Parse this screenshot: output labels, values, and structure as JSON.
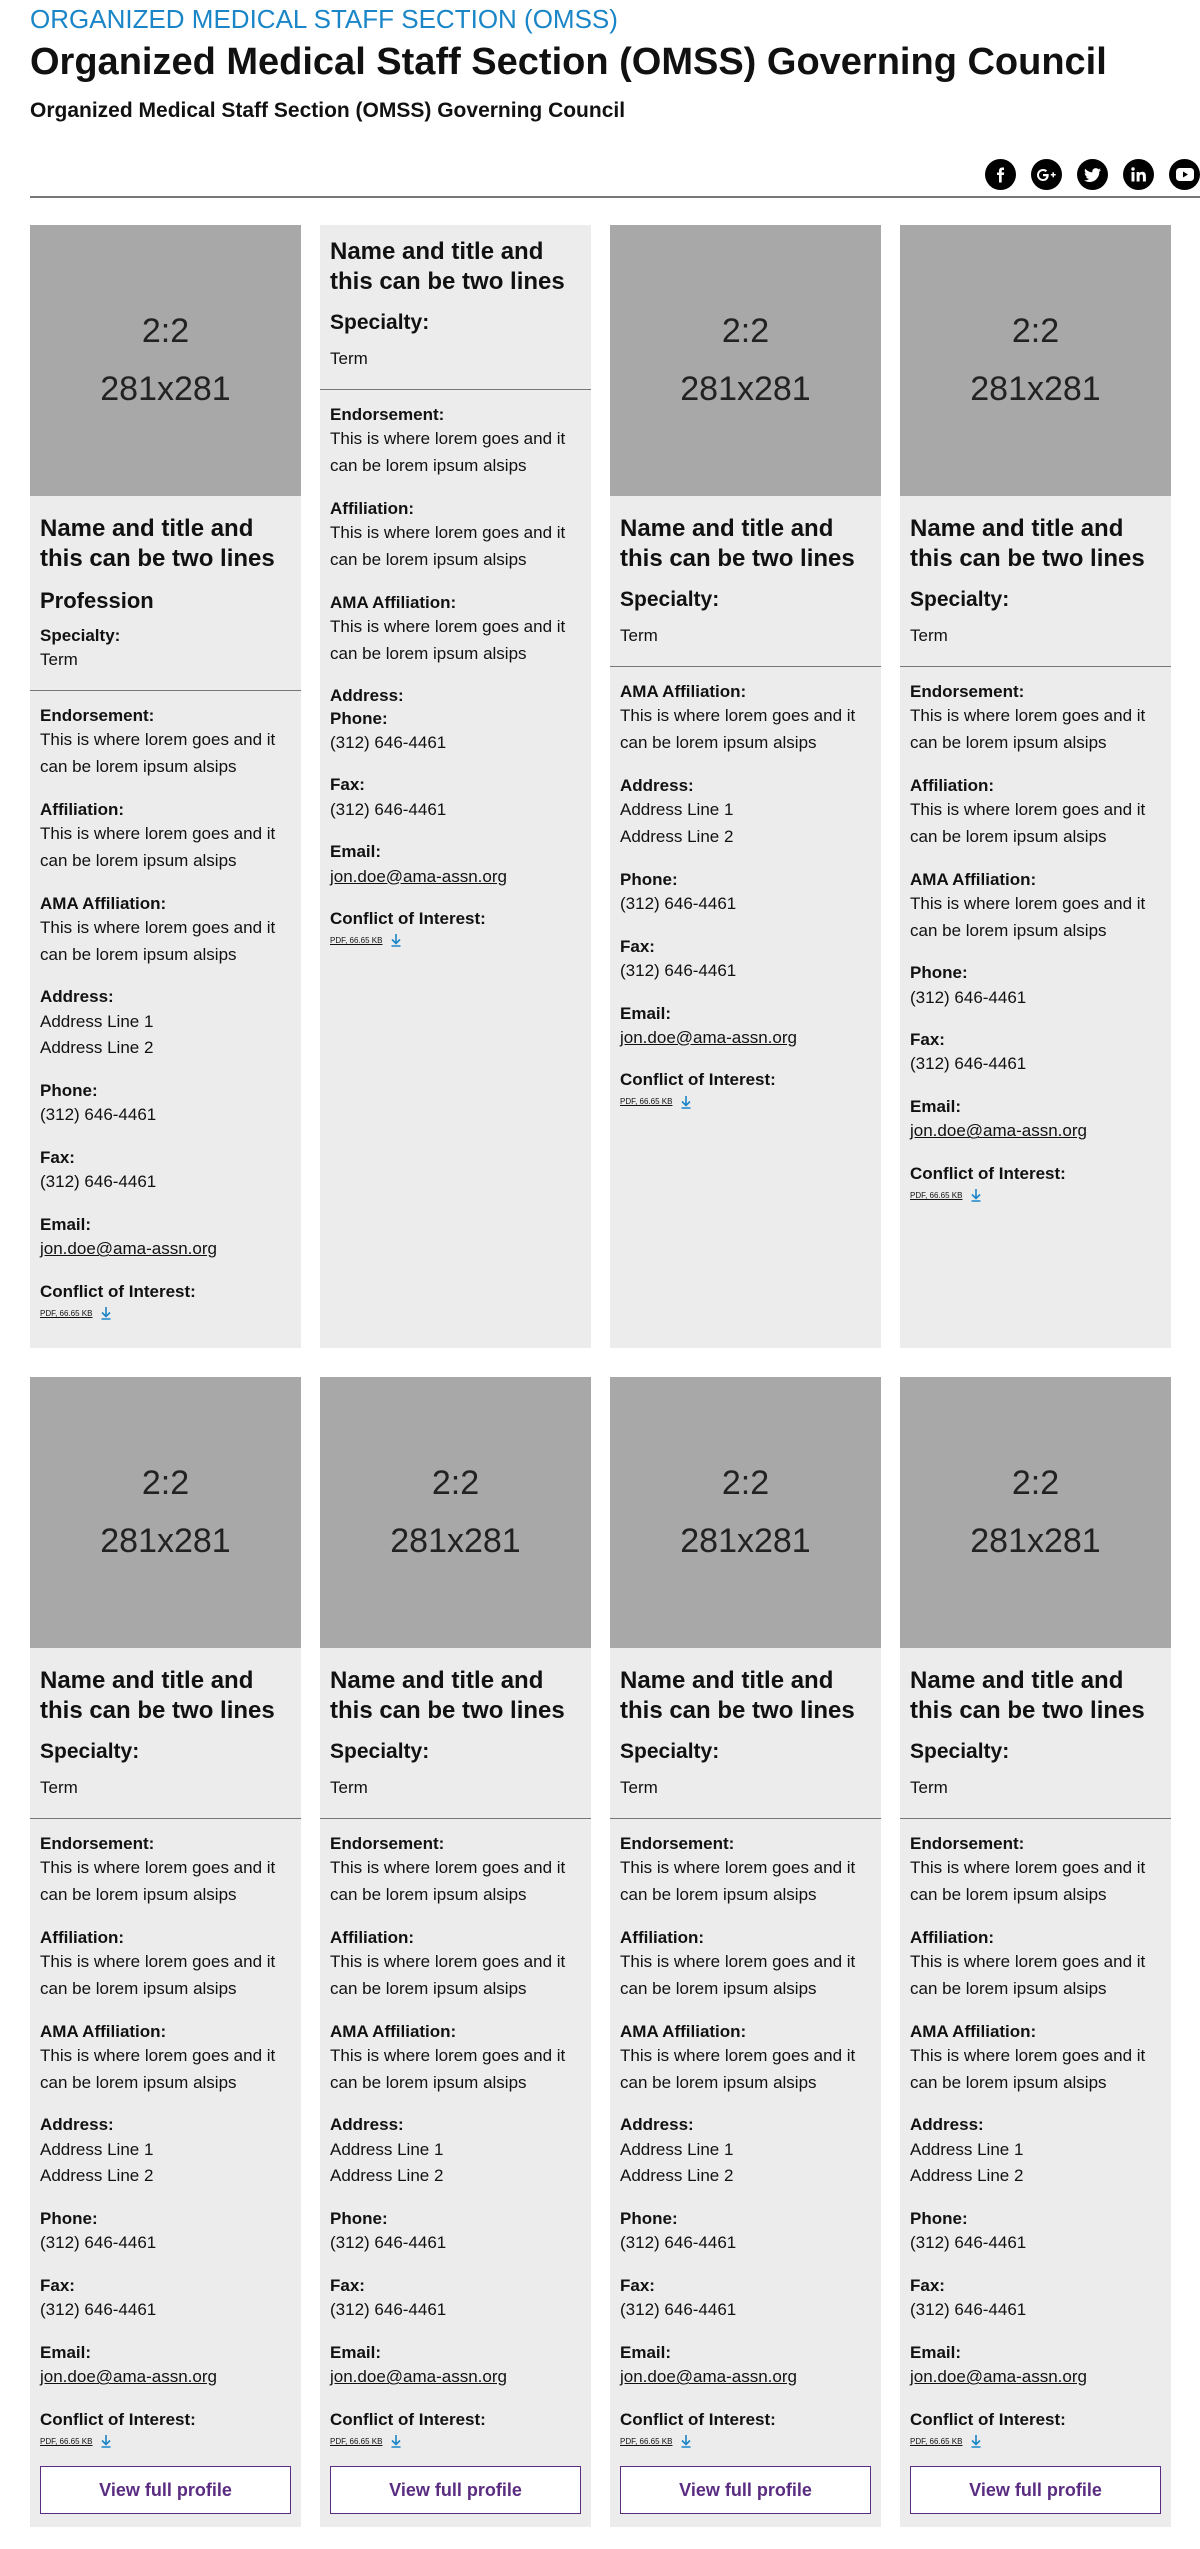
{
  "header": {
    "eyebrow": "ORGANIZED MEDICAL STAFF SECTION (OMSS)",
    "title": "Organized Medical Staff Section (OMSS) Governing Council",
    "subtitle": "Organized Medical Staff Section (OMSS) Governing Council"
  },
  "social": [
    {
      "name": "facebook-icon",
      "glyph": "f"
    },
    {
      "name": "google-plus-icon",
      "glyph": "G+"
    },
    {
      "name": "twitter-icon",
      "glyph": "t"
    },
    {
      "name": "linkedin-icon",
      "glyph": "in"
    },
    {
      "name": "youtube-icon",
      "glyph": "▶"
    }
  ],
  "labels": {
    "photo_ratio": "2:2",
    "photo_size": "281x281",
    "name": "Name and title and this can be two lines",
    "profession": "Profession",
    "specialty": "Specialty:",
    "term": "Term",
    "endorsement": "Endorsement:",
    "affiliation": "Affiliation:",
    "ama_affiliation": "AMA Affiliation:",
    "address": "Address:",
    "phone": "Phone:",
    "fax": "Fax:",
    "email": "Email:",
    "conflict": "Conflict of Interest:",
    "lorem": "This is where lorem goes and it can be lorem ipsum alsips",
    "address_line1": "Address Line 1",
    "address_line2": "Address Line 2",
    "phone_value": "(312) 646-4461",
    "fax_value": "(312) 646-4461",
    "email_value": "jon.doe@ama-assn.org",
    "pdf": "PDF, 66.65 KB",
    "view_profile": "View full profile"
  }
}
